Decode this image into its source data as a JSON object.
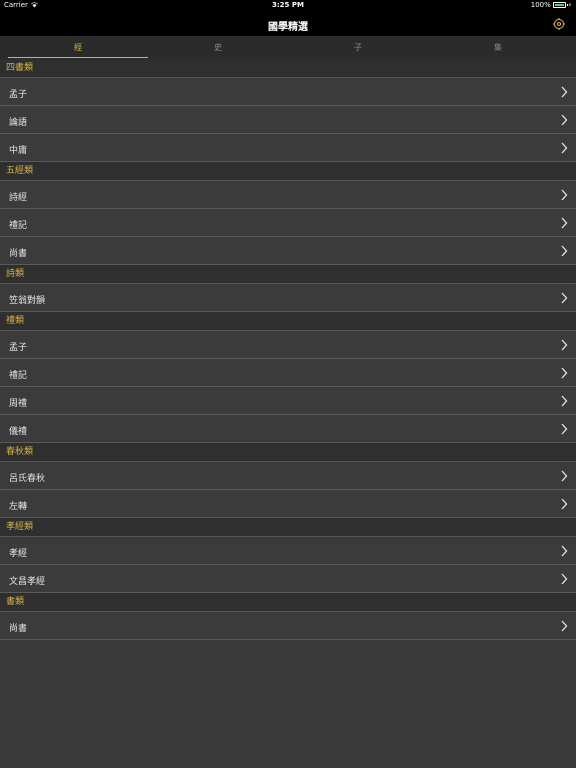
{
  "status": {
    "carrier": "Carrier",
    "time": "3:25 PM",
    "battery": "100%"
  },
  "nav": {
    "title": "國學精選"
  },
  "tabs": [
    {
      "label": "經",
      "active": true
    },
    {
      "label": "史",
      "active": false
    },
    {
      "label": "子",
      "active": false
    },
    {
      "label": "集",
      "active": false
    }
  ],
  "sections": [
    {
      "title": "四書類",
      "items": [
        "孟子",
        "論語",
        "中庸"
      ]
    },
    {
      "title": "五經類",
      "items": [
        "詩經",
        "禮記",
        "尚書"
      ]
    },
    {
      "title": "詩類",
      "items": [
        "笠翁對韻"
      ]
    },
    {
      "title": "禮類",
      "items": [
        "孟子",
        "禮記",
        "周禮",
        "儀禮"
      ]
    },
    {
      "title": "春秋類",
      "items": [
        "呂氏春秋",
        "左轉"
      ]
    },
    {
      "title": "孝經類",
      "items": [
        "孝經",
        "文昌孝經"
      ]
    },
    {
      "title": "書類",
      "items": [
        "尚書"
      ]
    }
  ],
  "colors": {
    "accent": "#d6b248",
    "background": "#3a3a3a",
    "header": "#2f2f2f"
  }
}
